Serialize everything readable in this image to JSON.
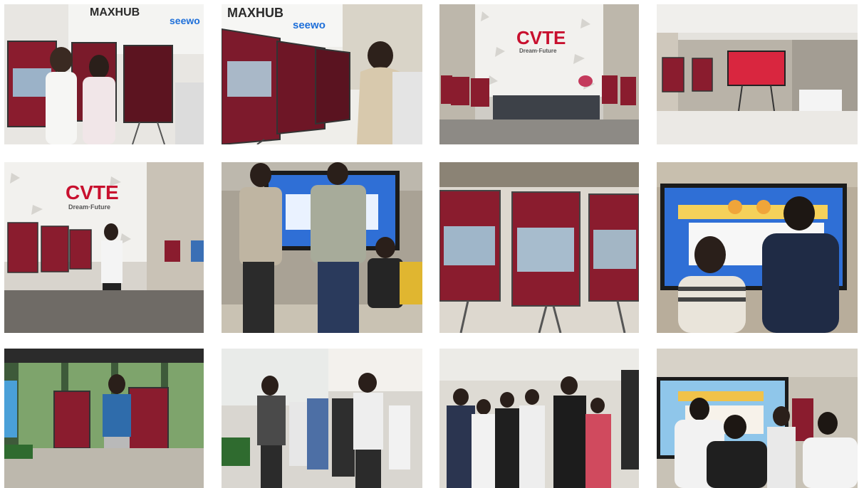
{
  "photos": [
    {
      "id": "r1c1",
      "logos": {
        "maxhub": "MAXHUB",
        "seewo": "seewo"
      }
    },
    {
      "id": "r1c2",
      "logos": {
        "maxhub": "MAXHUB",
        "seewo": "seewo"
      }
    },
    {
      "id": "r1c3",
      "logos": {
        "cvte": "CVTE",
        "tagline": "Dream·Future"
      }
    },
    {
      "id": "r1c4"
    },
    {
      "id": "r2c1",
      "logos": {
        "cvte": "CVTE",
        "tagline": "Dream·Future"
      }
    },
    {
      "id": "r2c2"
    },
    {
      "id": "r2c3"
    },
    {
      "id": "r2c4"
    },
    {
      "id": "r3c1"
    },
    {
      "id": "r3c2"
    },
    {
      "id": "r3c3"
    },
    {
      "id": "r3c4"
    }
  ],
  "colors": {
    "poster_red": "#8a1c2e",
    "screen_blue": "#2f6fd6",
    "logo_red": "#c8102e",
    "logo_dark": "#2b2b2b",
    "seewo_blue": "#1e6fd9"
  }
}
